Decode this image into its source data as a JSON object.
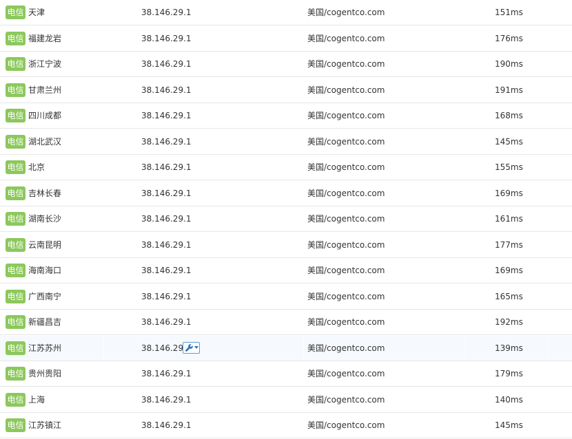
{
  "isp_label": "电信",
  "colors": {
    "badge": "#8cc85c",
    "tool_button_border": "#5b9ad5",
    "tool_icon": "#2f75c0",
    "row_divider": "#e6e6e6"
  },
  "icons": {
    "tool": "wrench-icon",
    "dropdown": "caret-down-icon"
  },
  "rows": [
    {
      "city": "天津",
      "ip": "38.146.29.1",
      "location": "美国/cogentco.com",
      "latency": "151ms"
    },
    {
      "city": "福建龙岩",
      "ip": "38.146.29.1",
      "location": "美国/cogentco.com",
      "latency": "176ms"
    },
    {
      "city": "浙江宁波",
      "ip": "38.146.29.1",
      "location": "美国/cogentco.com",
      "latency": "190ms"
    },
    {
      "city": "甘肃兰州",
      "ip": "38.146.29.1",
      "location": "美国/cogentco.com",
      "latency": "191ms"
    },
    {
      "city": "四川成都",
      "ip": "38.146.29.1",
      "location": "美国/cogentco.com",
      "latency": "168ms"
    },
    {
      "city": "湖北武汉",
      "ip": "38.146.29.1",
      "location": "美国/cogentco.com",
      "latency": "145ms"
    },
    {
      "city": "北京",
      "ip": "38.146.29.1",
      "location": "美国/cogentco.com",
      "latency": "155ms"
    },
    {
      "city": "吉林长春",
      "ip": "38.146.29.1",
      "location": "美国/cogentco.com",
      "latency": "169ms"
    },
    {
      "city": "湖南长沙",
      "ip": "38.146.29.1",
      "location": "美国/cogentco.com",
      "latency": "161ms"
    },
    {
      "city": "云南昆明",
      "ip": "38.146.29.1",
      "location": "美国/cogentco.com",
      "latency": "177ms"
    },
    {
      "city": "海南海口",
      "ip": "38.146.29.1",
      "location": "美国/cogentco.com",
      "latency": "169ms"
    },
    {
      "city": "广西南宁",
      "ip": "38.146.29.1",
      "location": "美国/cogentco.com",
      "latency": "165ms"
    },
    {
      "city": "新疆昌吉",
      "ip": "38.146.29.1",
      "location": "美国/cogentco.com",
      "latency": "192ms"
    },
    {
      "city": "江苏苏州",
      "ip": "38.146.29.1",
      "location": "美国/cogentco.com",
      "latency": "139ms",
      "hovered": true
    },
    {
      "city": "贵州贵阳",
      "ip": "38.146.29.1",
      "location": "美国/cogentco.com",
      "latency": "179ms"
    },
    {
      "city": "上海",
      "ip": "38.146.29.1",
      "location": "美国/cogentco.com",
      "latency": "140ms"
    },
    {
      "city": "江苏镇江",
      "ip": "38.146.29.1",
      "location": "美国/cogentco.com",
      "latency": "145ms"
    }
  ]
}
